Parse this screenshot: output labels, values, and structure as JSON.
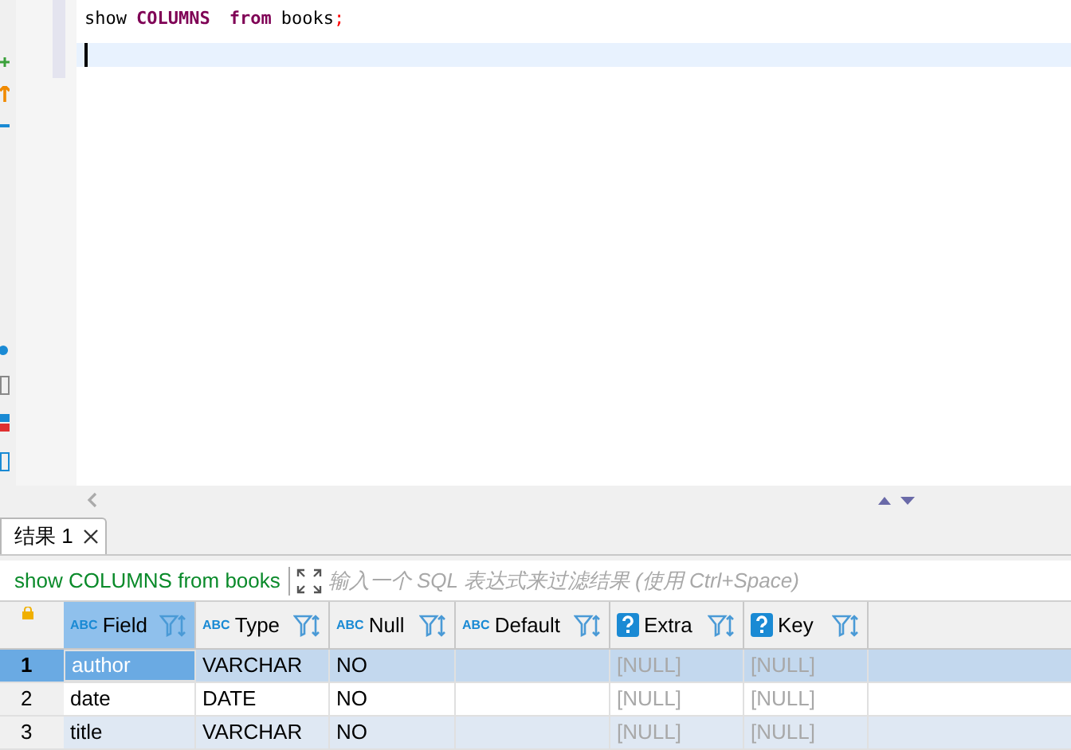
{
  "editor": {
    "lines": [
      {
        "current": false,
        "tokens": [
          {
            "text": "show",
            "kind": "plain"
          },
          {
            "text": "COLUMNS",
            "kind": "keyword"
          },
          {
            "text": "from",
            "kind": "keyword"
          },
          {
            "text": "books",
            "kind": "plain"
          },
          {
            "text": ";",
            "kind": "punct"
          }
        ]
      },
      {
        "current": true
      }
    ]
  },
  "result_tabs": [
    {
      "label": "结果 1",
      "selected": true
    }
  ],
  "filter": {
    "query": "show COLUMNS from books",
    "placeholder": "输入一个 SQL 表达式来过滤结果 (使用 Ctrl+Space)"
  },
  "table": {
    "columns": [
      {
        "name": "Field",
        "kind": "text",
        "badge": "ABC",
        "selected": true
      },
      {
        "name": "Type",
        "kind": "text",
        "badge": "ABC",
        "selected": false
      },
      {
        "name": "Null",
        "kind": "text",
        "badge": "ABC",
        "selected": false
      },
      {
        "name": "Default",
        "kind": "text",
        "badge": "ABC",
        "selected": false
      },
      {
        "name": "Extra",
        "kind": "unknown",
        "selected": false
      },
      {
        "name": "Key",
        "kind": "unknown",
        "selected": false
      }
    ],
    "rows": [
      {
        "number": "1",
        "selected": true,
        "cells": [
          {
            "text": "author",
            "kind": "value"
          },
          {
            "text": "VARCHAR",
            "kind": "value"
          },
          {
            "text": "NO",
            "kind": "value"
          },
          {
            "kind": "empty"
          },
          {
            "text": "[NULL]",
            "kind": "null"
          },
          {
            "text": "[NULL]",
            "kind": "null"
          }
        ]
      },
      {
        "number": "2",
        "selected": false,
        "cells": [
          {
            "text": "date",
            "kind": "value"
          },
          {
            "text": "DATE",
            "kind": "value"
          },
          {
            "text": "NO",
            "kind": "value"
          },
          {
            "kind": "empty"
          },
          {
            "text": "[NULL]",
            "kind": "null"
          },
          {
            "text": "[NULL]",
            "kind": "null"
          }
        ]
      },
      {
        "number": "3",
        "selected": false,
        "cells": [
          {
            "text": "title",
            "kind": "value"
          },
          {
            "text": "VARCHAR",
            "kind": "value"
          },
          {
            "text": "NO",
            "kind": "value"
          },
          {
            "kind": "empty"
          },
          {
            "text": "[NULL]",
            "kind": "null"
          },
          {
            "text": "[NULL]",
            "kind": "null"
          }
        ]
      }
    ]
  }
}
